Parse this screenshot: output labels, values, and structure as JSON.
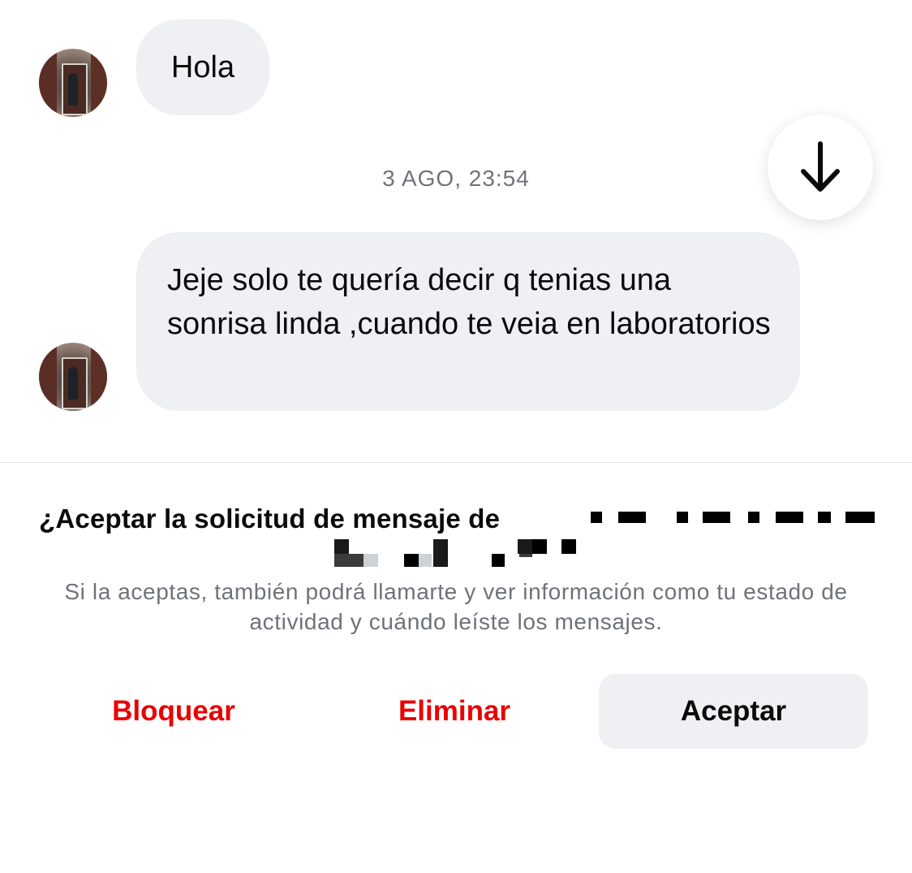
{
  "messages": [
    {
      "text": "Hola"
    },
    {
      "text": "Jeje solo te quería decir q tenias una sonrisa linda ,cuando te veia en laboratorios"
    }
  ],
  "timestamp": "3 AGO, 23:54",
  "icons": {
    "scroll_down": "arrow-down-icon",
    "avatar": "profile-photo"
  },
  "request": {
    "title": "¿Aceptar la solicitud de mensaje de",
    "info": "Si la aceptas, también podrá llamarte y ver información como tu estado de actividad y cuándo leíste los mensajes.",
    "block_label": "Bloquear",
    "delete_label": "Eliminar",
    "accept_label": "Aceptar"
  },
  "colors": {
    "destructive": "#ea0000",
    "bubble_bg": "#eff0f4",
    "secondary_text": "#707378"
  }
}
